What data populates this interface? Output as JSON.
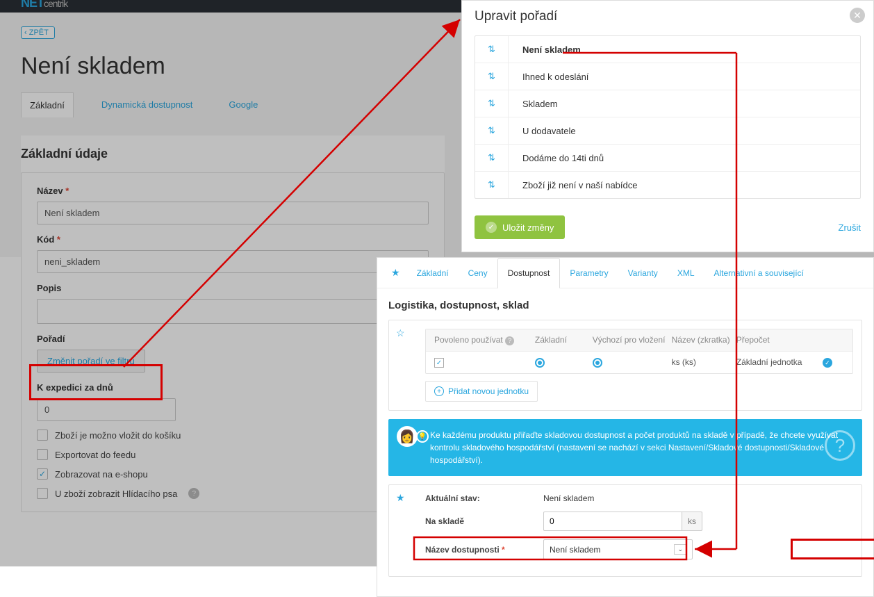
{
  "header": {
    "logo_prefix": "NET",
    "logo_suffix": "centrik"
  },
  "page": {
    "back": "ZPĚT",
    "title": "Není skladem",
    "tabs": [
      "Základní",
      "Dynamická dostupnost",
      "Google"
    ],
    "section_title": "Základní údaje",
    "form": {
      "name_label": "Název",
      "name_value": "Není skladem",
      "code_label": "Kód",
      "code_value": "neni_skladem",
      "desc_label": "Popis",
      "desc_value": "",
      "order_label": "Pořadí",
      "order_btn": "Změnit pořadí ve filtru",
      "expedition_label": "K expedici za dnů",
      "expedition_value": "0",
      "checks": {
        "c1": "Zboží je možno vložit do košíku",
        "c2": "Exportovat do feedu",
        "c3": "Zobrazovat na e-shopu",
        "c4": "U zboží zobrazit Hlídacího psa"
      }
    }
  },
  "modal": {
    "title": "Upravit pořadí",
    "items": [
      "Není skladem",
      "Ihned k odeslání",
      "Skladem",
      "U dodavatele",
      "Dodáme do 14ti dnů",
      "Zboží již není v naší nabídce"
    ],
    "save": "Uložit změny",
    "cancel": "Zrušit"
  },
  "bottom": {
    "tabs": [
      "Základní",
      "Ceny",
      "Dostupnost",
      "Parametry",
      "Varianty",
      "XML",
      "Alternativní a související"
    ],
    "heading": "Logistika, dostupnost, sklad",
    "table": {
      "hdr": [
        "Povoleno používat",
        "Základní",
        "Výchozí pro vložení",
        "Název (zkratka)",
        "Přepočet"
      ],
      "row": {
        "name": "ks (ks)",
        "prepocet": "Základní jednotka"
      }
    },
    "add_unit": "Přidat novou jednotku",
    "info": "Ke každému produktu přiřaďte skladovou dostupnost a počet produktů na skladě v případě, že chcete využívat kontrolu skladového hospodářství (nastavení se nachází v sekci Nastavení/Skladové dostupnosti/Skladové hospodářství).",
    "form": {
      "actual_label": "Aktuální stav:",
      "actual_value": "Není skladem",
      "stock_label": "Na skladě",
      "stock_value": "0",
      "stock_unit": "ks",
      "avail_label": "Název dostupnosti",
      "avail_value": "Není skladem"
    }
  }
}
